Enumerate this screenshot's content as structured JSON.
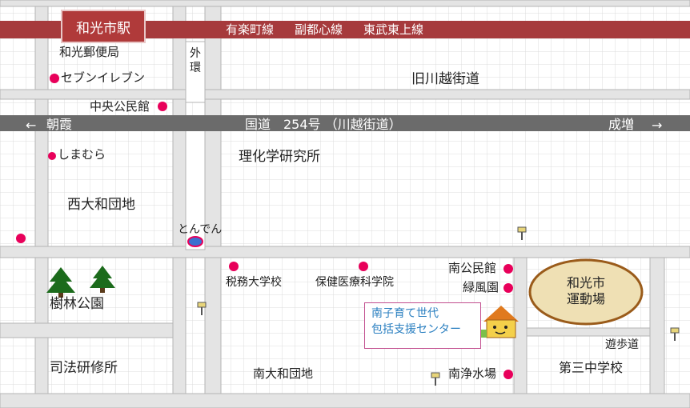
{
  "station": {
    "name": "和光市駅"
  },
  "rail_lines": [
    "有楽町線",
    "副都心線",
    "東武東上線"
  ],
  "roads": {
    "outer_ring": "外環",
    "old_kawagoe": "旧川越街道",
    "route254": "国道　254号 （川越街道）",
    "left_dir": "朝霞",
    "right_dir": "成増",
    "left_arrow": "←",
    "right_arrow": "→",
    "promenade": "遊歩道"
  },
  "places": {
    "post_office": "和光郵便局",
    "seven_eleven": "セブンイレブン",
    "central_hall": "中央公民館",
    "shimamura": "しまむら",
    "riken": "理化学研究所",
    "nishi_danchi": "西大和団地",
    "tonden": "とんでん",
    "forest_park": "樹林公園",
    "tax_college": "税務大学校",
    "health_college": "保健医療科学院",
    "minami_hall": "南公民館",
    "ryokufuen": "緑風園",
    "stadium": "和光市\n運動場",
    "stadium_l1": "和光市",
    "stadium_l2": "運動場",
    "legal_institute": "司法研修所",
    "minami_danchi": "南大和団地",
    "water_plant": "南浄水場",
    "third_jhs": "第三中学校"
  },
  "highlight": {
    "line1": "南子育て世代",
    "line2": "包括支援センター"
  },
  "colors": {
    "rail": "#a63a3c",
    "road": "#6b6b6b",
    "block": "#e4e4e4",
    "marker": "#e8005a",
    "stadium_fill": "#efe0b4",
    "stadium_border": "#9a5b1a",
    "highlight_text": "#2a7fc0",
    "highlight_border": "#c24f8f"
  }
}
